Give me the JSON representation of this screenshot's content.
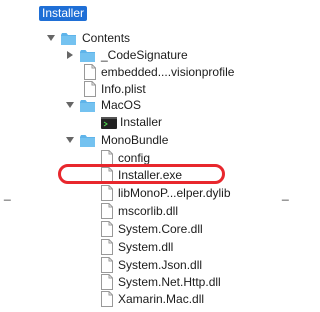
{
  "root": {
    "label": "Installer"
  },
  "tree": {
    "contents": "Contents",
    "code_signature": "_CodeSignature",
    "embedded_profile": "embedded....visionprofile",
    "info_plist": "Info.plist",
    "macos": "MacOS",
    "macos_installer": "Installer",
    "mono_bundle": "MonoBundle",
    "config": "config",
    "installer_exe": "Installer.exe",
    "libmono": "libMonoP...elper.dylib",
    "mscorlib": "mscorlib.dll",
    "system_core": "System.Core.dll",
    "system": "System.dll",
    "system_json": "System.Json.dll",
    "system_net_http": "System.Net.Http.dll",
    "xamarin_mac": "Xamarin.Mac.dll"
  },
  "colors": {
    "selection": "#1f6fd6",
    "folder": "#5fb4ea",
    "highlight_ring": "#e8272d"
  },
  "icons": {
    "folder": "folder-icon",
    "file": "document-icon",
    "executable": "terminal-icon"
  }
}
